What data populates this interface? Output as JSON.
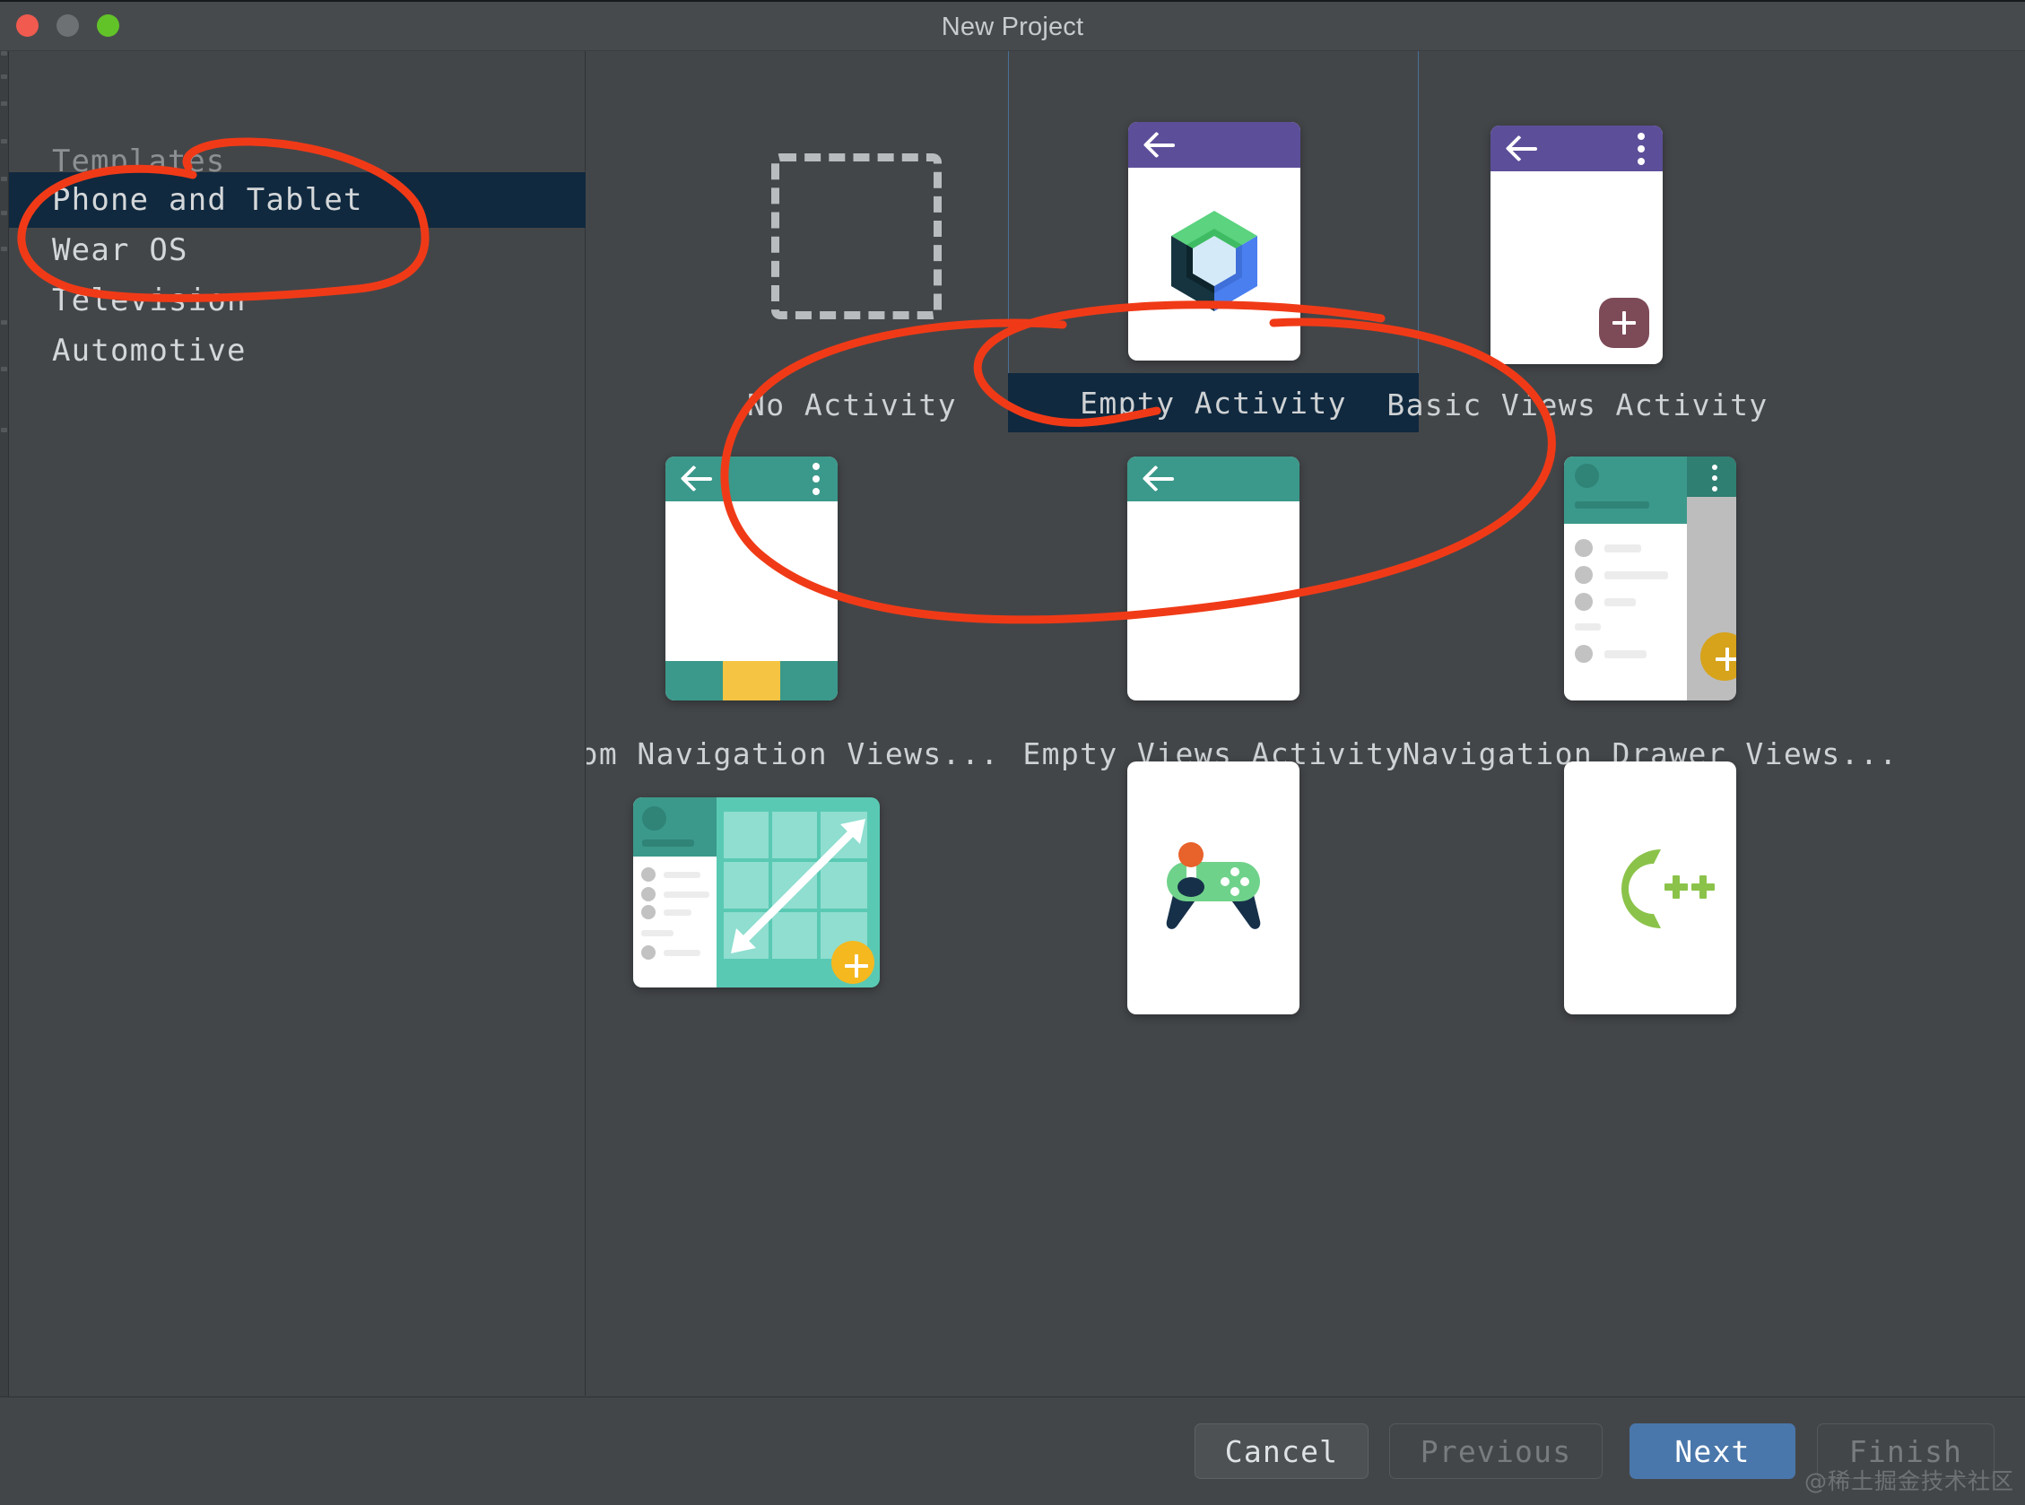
{
  "window": {
    "title": "New Project",
    "controls": [
      "close",
      "minimize",
      "zoom"
    ]
  },
  "sidebar": {
    "header": "Templates",
    "items": [
      {
        "label": "Phone and Tablet",
        "selected": true
      },
      {
        "label": "Wear OS",
        "selected": false
      },
      {
        "label": "Television",
        "selected": false
      },
      {
        "label": "Automotive",
        "selected": false
      }
    ]
  },
  "templates": [
    {
      "label": "No Activity",
      "art": "dashed-box",
      "selected": false
    },
    {
      "label": "Empty Activity",
      "art": "compose-logo",
      "selected": true
    },
    {
      "label": "Basic Views Activity",
      "art": "purple-fab",
      "selected": false
    },
    {
      "label": "Bottom Navigation Views...",
      "art": "bottom-nav",
      "selected": false
    },
    {
      "label": "Empty Views Activity",
      "art": "teal-empty",
      "selected": false
    },
    {
      "label": "Navigation Drawer Views...",
      "art": "nav-drawer",
      "selected": false
    },
    {
      "label": "",
      "art": "responsive-views",
      "selected": false
    },
    {
      "label": "",
      "art": "game-controller",
      "selected": false
    },
    {
      "label": "",
      "art": "cpp-logo",
      "selected": false
    }
  ],
  "buttons": [
    {
      "label": "Cancel",
      "state": "normal"
    },
    {
      "label": "Previous",
      "state": "disabled"
    },
    {
      "label": "Next",
      "state": "primary"
    },
    {
      "label": "Finish",
      "state": "disabled"
    }
  ],
  "annotations": {
    "color": "#f03a17",
    "marks": [
      "circle-phone-and-tablet",
      "circle-empty-activity"
    ]
  },
  "watermark": "@稀土掘金技术社区",
  "colors": {
    "background": "#434649",
    "selection": "#10293f",
    "accent_primary": "#4a77ab",
    "annotation_red": "#f03a17",
    "compose_green": "#5bd37f",
    "compose_blue": "#4a7ff0",
    "material_purple": "#5d4e9a",
    "material_teal": "#3b998b",
    "material_amber": "#f5c442",
    "cpp_green": "#8bc34a"
  }
}
